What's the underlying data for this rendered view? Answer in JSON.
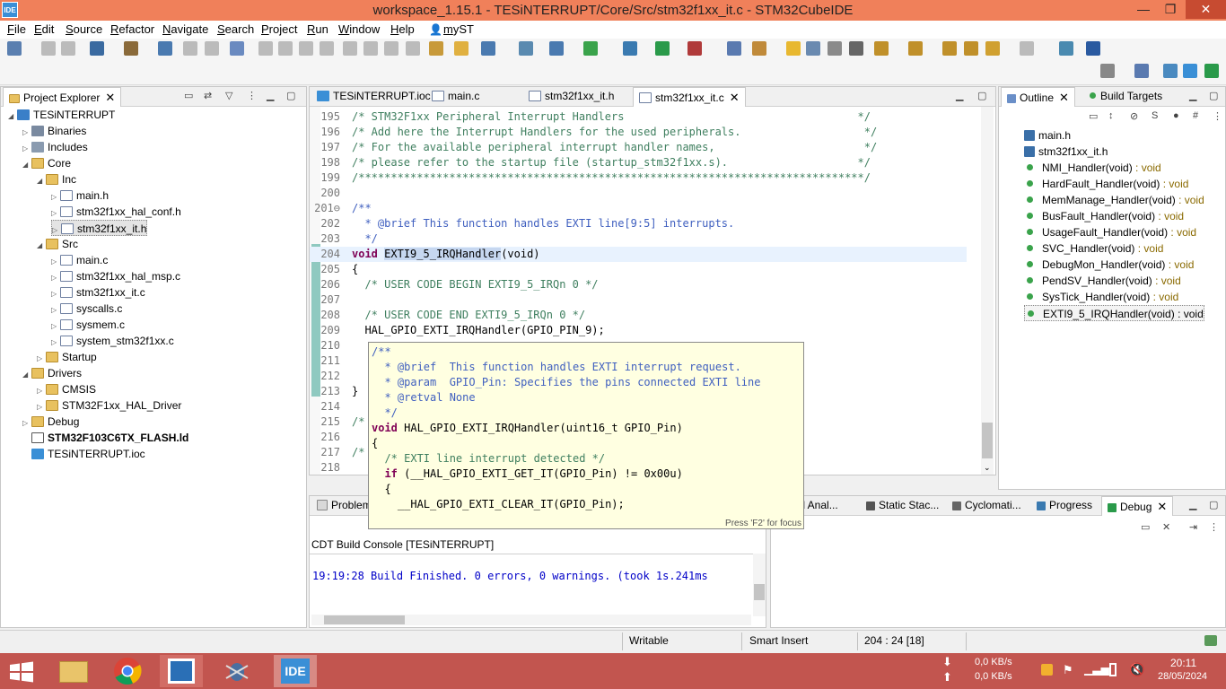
{
  "window": {
    "app_icon_text": "IDE",
    "title": "workspace_1.15.1 - TESiNTERRUPT/Core/Src/stm32f1xx_it.c - STM32CubeIDE",
    "minimize": "—",
    "maximize": "❐",
    "close": "✕"
  },
  "menu": [
    "File",
    "Edit",
    "Source",
    "Refactor",
    "Navigate",
    "Search",
    "Project",
    "Run",
    "Window",
    "Help",
    "myST"
  ],
  "project_explorer": {
    "tab_label": "Project Explorer",
    "tree": [
      {
        "label": "TESiNTERRUPT",
        "icon": "project-icon",
        "indent": 0,
        "twist": "◢"
      },
      {
        "label": "Binaries",
        "icon": "binaries-icon",
        "indent": 1,
        "twist": "▷"
      },
      {
        "label": "Includes",
        "icon": "includes-icon",
        "indent": 1,
        "twist": "▷"
      },
      {
        "label": "Core",
        "icon": "folder-icon",
        "indent": 1,
        "twist": "◢"
      },
      {
        "label": "Inc",
        "icon": "folder-icon",
        "indent": 2,
        "twist": "◢"
      },
      {
        "label": "main.h",
        "icon": "header-file-icon",
        "indent": 3,
        "twist": "▷"
      },
      {
        "label": "stm32f1xx_hal_conf.h",
        "icon": "header-file-icon",
        "indent": 3,
        "twist": "▷"
      },
      {
        "label": "stm32f1xx_it.h",
        "icon": "header-file-icon",
        "indent": 3,
        "twist": "▷"
      },
      {
        "label": "Src",
        "icon": "folder-icon",
        "indent": 2,
        "twist": "◢"
      },
      {
        "label": "main.c",
        "icon": "c-file-icon",
        "indent": 3,
        "twist": "▷"
      },
      {
        "label": "stm32f1xx_hal_msp.c",
        "icon": "c-file-icon",
        "indent": 3,
        "twist": "▷"
      },
      {
        "label": "stm32f1xx_it.c",
        "icon": "c-file-icon",
        "indent": 3,
        "twist": "▷"
      },
      {
        "label": "syscalls.c",
        "icon": "c-file-icon",
        "indent": 3,
        "twist": "▷"
      },
      {
        "label": "sysmem.c",
        "icon": "c-file-icon",
        "indent": 3,
        "twist": "▷"
      },
      {
        "label": "system_stm32f1xx.c",
        "icon": "c-file-icon",
        "indent": 3,
        "twist": "▷"
      },
      {
        "label": "Startup",
        "icon": "folder-icon",
        "indent": 2,
        "twist": "▷"
      },
      {
        "label": "Drivers",
        "icon": "folder-icon",
        "indent": 1,
        "twist": "◢"
      },
      {
        "label": "CMSIS",
        "icon": "folder-icon",
        "indent": 2,
        "twist": "▷"
      },
      {
        "label": "STM32F1xx_HAL_Driver",
        "icon": "folder-icon",
        "indent": 2,
        "twist": "▷"
      },
      {
        "label": "Debug",
        "icon": "folder-icon",
        "indent": 1,
        "twist": "▷"
      },
      {
        "label": "STM32F103C6TX_FLASH.ld",
        "icon": "linker-file-icon",
        "indent": 1,
        "twist": ""
      },
      {
        "label": "TESiNTERRUPT.ioc",
        "icon": "mx-file-icon",
        "indent": 1,
        "twist": ""
      }
    ]
  },
  "editor": {
    "tabs": [
      {
        "label": "TESiNTERRUPT.ioc",
        "active": false
      },
      {
        "label": "main.c",
        "active": false
      },
      {
        "label": "stm32f1xx_it.h",
        "active": false
      },
      {
        "label": "stm32f1xx_it.c",
        "active": true
      }
    ],
    "lines": [
      {
        "n": "195",
        "text": "/* STM32F1xx Peripheral Interrupt Handlers                                    */",
        "cls": "cm"
      },
      {
        "n": "196",
        "text": "/* Add here the Interrupt Handlers for the used peripherals.                   */",
        "cls": "cm"
      },
      {
        "n": "197",
        "text": "/* For the available peripheral interrupt handler names,                       */",
        "cls": "cm"
      },
      {
        "n": "198",
        "text": "/* please refer to the startup file (startup_stm32f1xx.s).                    */",
        "cls": "cm"
      },
      {
        "n": "199",
        "text": "/******************************************************************************/",
        "cls": "cm"
      },
      {
        "n": "200",
        "text": "",
        "cls": ""
      },
      {
        "n": "201",
        "text": "/**",
        "cls": "cm-doc"
      },
      {
        "n": "202",
        "text": "  * @brief This function handles EXTI line[9:5] interrupts.",
        "cls": "cm-doc"
      },
      {
        "n": "203",
        "text": "  */",
        "cls": "cm-doc"
      },
      {
        "n": "204",
        "text": "",
        "cls": "special"
      },
      {
        "n": "205",
        "text": "{",
        "cls": ""
      },
      {
        "n": "206",
        "text": "  /* USER CODE BEGIN EXTI9_5_IRQn 0 */",
        "cls": "cm"
      },
      {
        "n": "207",
        "text": "",
        "cls": ""
      },
      {
        "n": "208",
        "text": "  /* USER CODE END EXTI9_5_IRQn 0 */",
        "cls": "cm"
      },
      {
        "n": "209",
        "text": "  HAL_GPIO_EXTI_IRQHandler(GPIO_PIN_9);",
        "cls": ""
      },
      {
        "n": "210",
        "text": "",
        "cls": ""
      },
      {
        "n": "211",
        "text": "",
        "cls": ""
      },
      {
        "n": "212",
        "text": "",
        "cls": ""
      },
      {
        "n": "213",
        "text": "}",
        "cls": ""
      },
      {
        "n": "214",
        "text": "",
        "cls": ""
      },
      {
        "n": "215",
        "text": "/*",
        "cls": "cm"
      },
      {
        "n": "216",
        "text": "",
        "cls": ""
      },
      {
        "n": "217",
        "text": "/*",
        "cls": "cm"
      },
      {
        "n": "218",
        "text": "",
        "cls": ""
      }
    ],
    "line204": {
      "kw": "void",
      "fn": "EXTI9_5_IRQHandler",
      "rest": "(void)"
    }
  },
  "hover": {
    "lines": [
      {
        "text": "/**",
        "cls": "cm-doc"
      },
      {
        "text": "  * @brief  This function handles EXTI interrupt request.",
        "cls": "cm-doc"
      },
      {
        "text": "  * @param  GPIO_Pin: Specifies the pins connected EXTI line",
        "cls": "cm-doc"
      },
      {
        "text": "  * @retval None",
        "cls": "cm-doc"
      },
      {
        "text": "  */",
        "cls": "cm-doc"
      },
      {
        "text": "void HAL_GPIO_EXTI_IRQHandler(uint16_t GPIO_Pin)",
        "cls": "sig"
      },
      {
        "text": "{",
        "cls": ""
      },
      {
        "text": "  /* EXTI line interrupt detected */",
        "cls": "cm"
      },
      {
        "text": "  if (__HAL_GPIO_EXTI_GET_IT(GPIO_Pin) != 0x00u)",
        "cls": "if"
      },
      {
        "text": "  {",
        "cls": ""
      },
      {
        "text": "    __HAL_GPIO_EXTI_CLEAR_IT(GPIO_Pin);",
        "cls": ""
      }
    ],
    "footer": "Press 'F2' for focus"
  },
  "outline": {
    "tabs": [
      "Outline",
      "Build Targets"
    ],
    "items": [
      {
        "name": "main.h",
        "type": "",
        "icon": "include-icon"
      },
      {
        "name": "stm32f1xx_it.h",
        "type": "",
        "icon": "include-icon"
      },
      {
        "name": "NMI_Handler(void)",
        "type": " : void",
        "icon": "function-icon"
      },
      {
        "name": "HardFault_Handler(void)",
        "type": " : void",
        "icon": "function-icon"
      },
      {
        "name": "MemManage_Handler(void)",
        "type": " : void",
        "icon": "function-icon"
      },
      {
        "name": "BusFault_Handler(void)",
        "type": " : void",
        "icon": "function-icon"
      },
      {
        "name": "UsageFault_Handler(void)",
        "type": " : void",
        "icon": "function-icon"
      },
      {
        "name": "SVC_Handler(void)",
        "type": " : void",
        "icon": "function-icon"
      },
      {
        "name": "DebugMon_Handler(void)",
        "type": " : void",
        "icon": "function-icon"
      },
      {
        "name": "PendSV_Handler(void)",
        "type": " : void",
        "icon": "function-icon"
      },
      {
        "name": "SysTick_Handler(void)",
        "type": " : void",
        "icon": "function-icon"
      },
      {
        "name": "EXTI9_5_IRQHandler(void)",
        "type": " : void",
        "icon": "function-icon",
        "selected": true
      }
    ]
  },
  "bottom": {
    "tabs_left": [
      "Problem"
    ],
    "tabs_right": [
      "ild Anal...",
      "Static Stac...",
      "Cyclomati...",
      "Progress",
      "Debug"
    ],
    "console_title": "CDT Build Console [TESiNTERRUPT]",
    "console_line": "19:19:28 Build Finished. 0 errors, 0 warnings. (took 1s.241ms"
  },
  "status": {
    "writable": "Writable",
    "insert_mode": "Smart Insert",
    "position": "204 : 24 [18]"
  },
  "taskbar": {
    "net_up": "0,0 KB/s",
    "net_down": "0,0 KB/s",
    "time": "20:11",
    "date": "28/05/2024",
    "ide_label": "IDE"
  }
}
